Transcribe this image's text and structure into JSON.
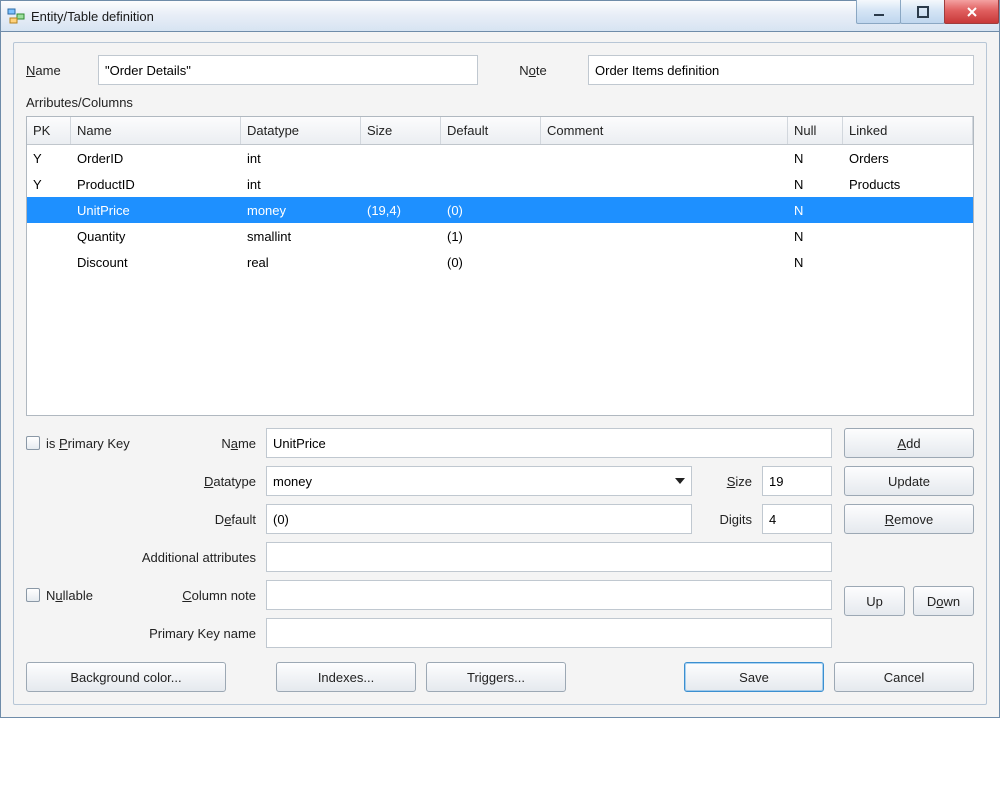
{
  "window": {
    "title": "Entity/Table definition"
  },
  "header": {
    "name_label": "Name",
    "name_value": "\"Order Details\"",
    "note_label": "Note",
    "note_value": "Order Items definition",
    "attributes_label": "Arributes/Columns"
  },
  "columns": {
    "pk": "PK",
    "name": "Name",
    "datatype": "Datatype",
    "size": "Size",
    "default": "Default",
    "comment": "Comment",
    "null": "Null",
    "linked": "Linked"
  },
  "rows": [
    {
      "pk": "Y",
      "name": "OrderID",
      "datatype": "int",
      "size": "",
      "default": "",
      "comment": "",
      "null": "N",
      "linked": "Orders",
      "selected": false
    },
    {
      "pk": "Y",
      "name": "ProductID",
      "datatype": "int",
      "size": "",
      "default": "",
      "comment": "",
      "null": "N",
      "linked": "Products",
      "selected": false
    },
    {
      "pk": "",
      "name": "UnitPrice",
      "datatype": "money",
      "size": "(19,4)",
      "default": "(0)",
      "comment": "",
      "null": "N",
      "linked": "",
      "selected": true
    },
    {
      "pk": "",
      "name": "Quantity",
      "datatype": "smallint",
      "size": "",
      "default": "(1)",
      "comment": "",
      "null": "N",
      "linked": "",
      "selected": false
    },
    {
      "pk": "",
      "name": "Discount",
      "datatype": "real",
      "size": "",
      "default": "(0)",
      "comment": "",
      "null": "N",
      "linked": "",
      "selected": false
    }
  ],
  "form": {
    "is_pk_label": "is Primary Key",
    "name_label": "Name",
    "name_value": "UnitPrice",
    "datatype_label": "Datatype",
    "datatype_value": "money",
    "size_label": "Size",
    "size_value": "19",
    "default_label": "Default",
    "default_value": "(0)",
    "digits_label": "Digits",
    "digits_value": "4",
    "additional_label": "Additional attributes",
    "additional_value": "",
    "nullable_label": "Nullable",
    "colnote_label": "Column note",
    "colnote_value": "",
    "pkname_label": "Primary Key name",
    "pkname_value": ""
  },
  "buttons": {
    "add": "Add",
    "update": "Update",
    "remove": "Remove",
    "up": "Up",
    "down": "Down",
    "bgcolor": "Background color...",
    "indexes": "Indexes...",
    "triggers": "Triggers...",
    "save": "Save",
    "cancel": "Cancel"
  }
}
